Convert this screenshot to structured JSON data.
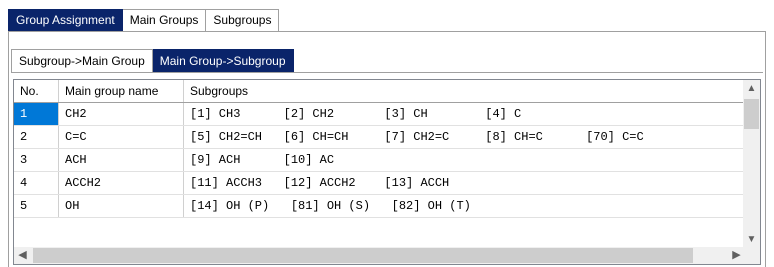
{
  "main_tabs": [
    {
      "label": "Group Assignment",
      "active": true
    },
    {
      "label": "Main Groups",
      "active": false
    },
    {
      "label": "Subgroups",
      "active": false
    }
  ],
  "sub_tabs": [
    {
      "label": "Subgroup->Main Group",
      "active": false
    },
    {
      "label": "Main Group->Subgroup",
      "active": true
    }
  ],
  "grid": {
    "headers": {
      "no": "No.",
      "main_group_name": "Main group name",
      "subgroups": "Subgroups"
    },
    "rows": [
      {
        "no": "1",
        "name": "CH2",
        "subgroups": "[1] CH3      [2] CH2       [3] CH        [4] C",
        "selected": true
      },
      {
        "no": "2",
        "name": "C=C",
        "subgroups": "[5] CH2=CH   [6] CH=CH     [7] CH2=C     [8] CH=C      [70] C=C",
        "selected": false
      },
      {
        "no": "3",
        "name": "ACH",
        "subgroups": "[9] ACH      [10] AC",
        "selected": false
      },
      {
        "no": "4",
        "name": "ACCH2",
        "subgroups": "[11] ACCH3   [12] ACCH2    [13] ACCH",
        "selected": false
      },
      {
        "no": "5",
        "name": "OH",
        "subgroups": "[14] OH (P)   [81] OH (S)   [82] OH (T)",
        "selected": false
      }
    ]
  },
  "icons": {
    "scroll_up": "▲",
    "scroll_down": "▼",
    "scroll_left": "◀",
    "scroll_right": "▶"
  },
  "colors": {
    "active_tab": "#0a246a",
    "selected_cell": "#0078d7"
  }
}
